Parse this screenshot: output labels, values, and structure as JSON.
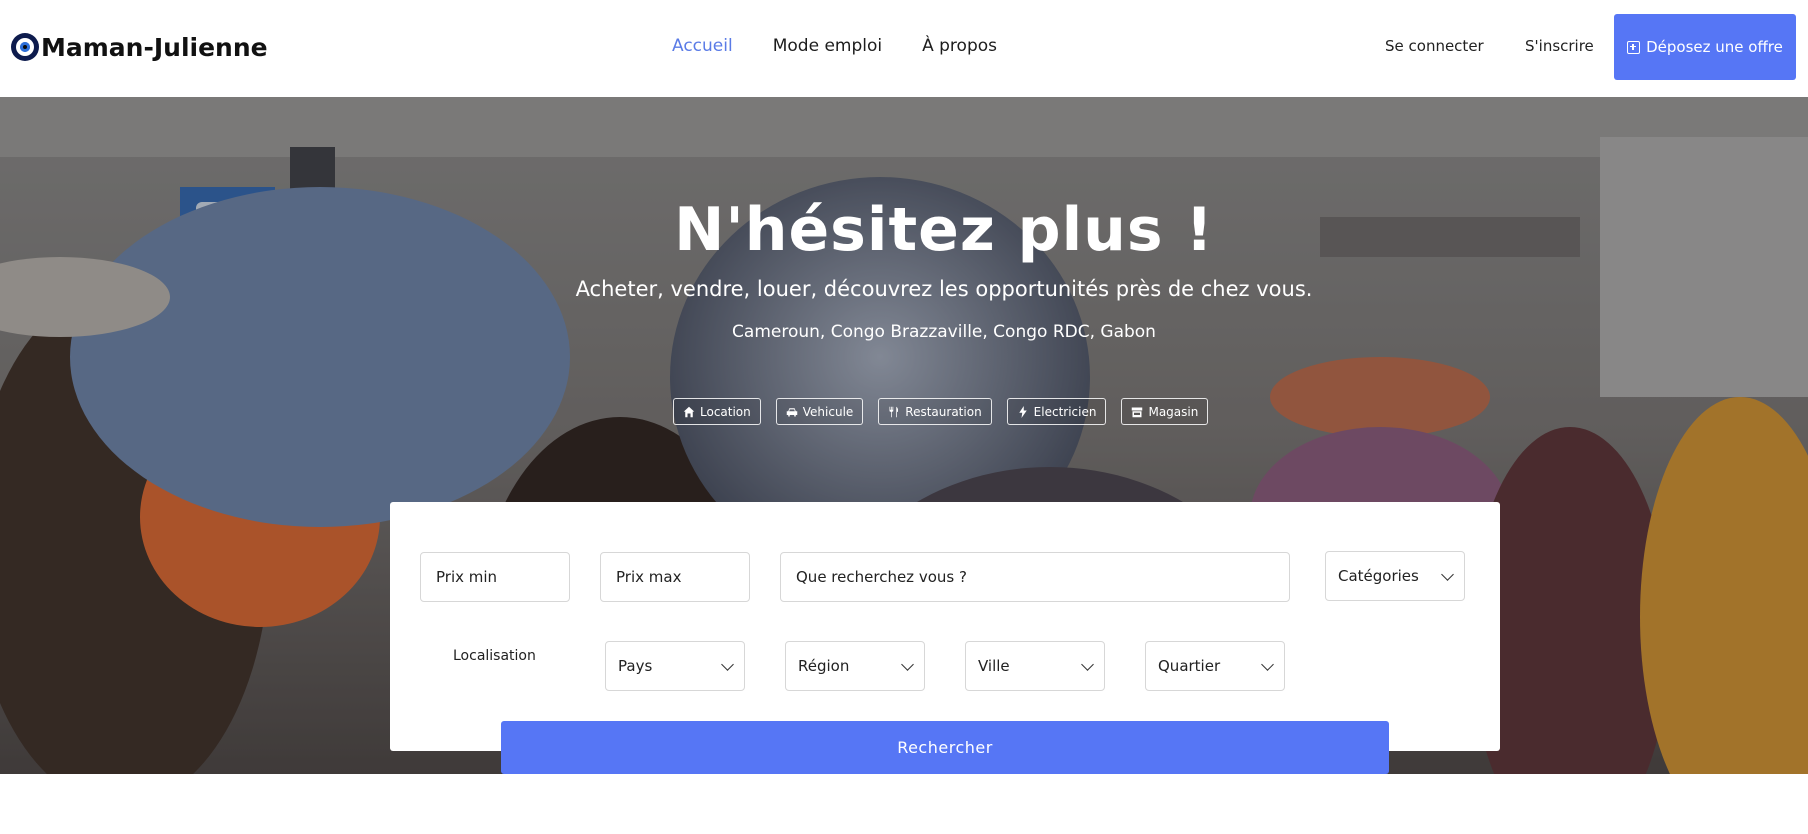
{
  "brand": {
    "name": "Maman-Julienne"
  },
  "nav": {
    "links": [
      {
        "label": "Accueil",
        "active": true
      },
      {
        "label": "Mode emploi",
        "active": false
      },
      {
        "label": "À propos",
        "active": false
      }
    ],
    "login": "Se connecter",
    "signup": "S'inscrire",
    "offer_button": "Déposez une offre"
  },
  "hero": {
    "title": "N'hésitez plus !",
    "subtitle": "Acheter, vendre, louer, découvrez les opportunités près de chez vous.",
    "countries": "Cameroun, Congo Brazzaville, Congo RDC, Gabon",
    "categories": [
      {
        "label": "Location",
        "icon": "home-icon"
      },
      {
        "label": "Vehicule",
        "icon": "car-icon"
      },
      {
        "label": "Restauration",
        "icon": "utensils-icon"
      },
      {
        "label": "Electricien",
        "icon": "bolt-icon"
      },
      {
        "label": "Magasin",
        "icon": "store-icon"
      }
    ]
  },
  "search": {
    "price_min_placeholder": "Prix min",
    "price_max_placeholder": "Prix max",
    "query_placeholder": "Que recherchez vous ?",
    "categories_select": "Catégories",
    "location_label": "Localisation",
    "country_select": "Pays",
    "region_select": "Région",
    "city_select": "Ville",
    "district_select": "Quartier",
    "submit": "Rechercher"
  },
  "colors": {
    "accent": "#5676f5",
    "nav_active": "#5a7be6"
  }
}
